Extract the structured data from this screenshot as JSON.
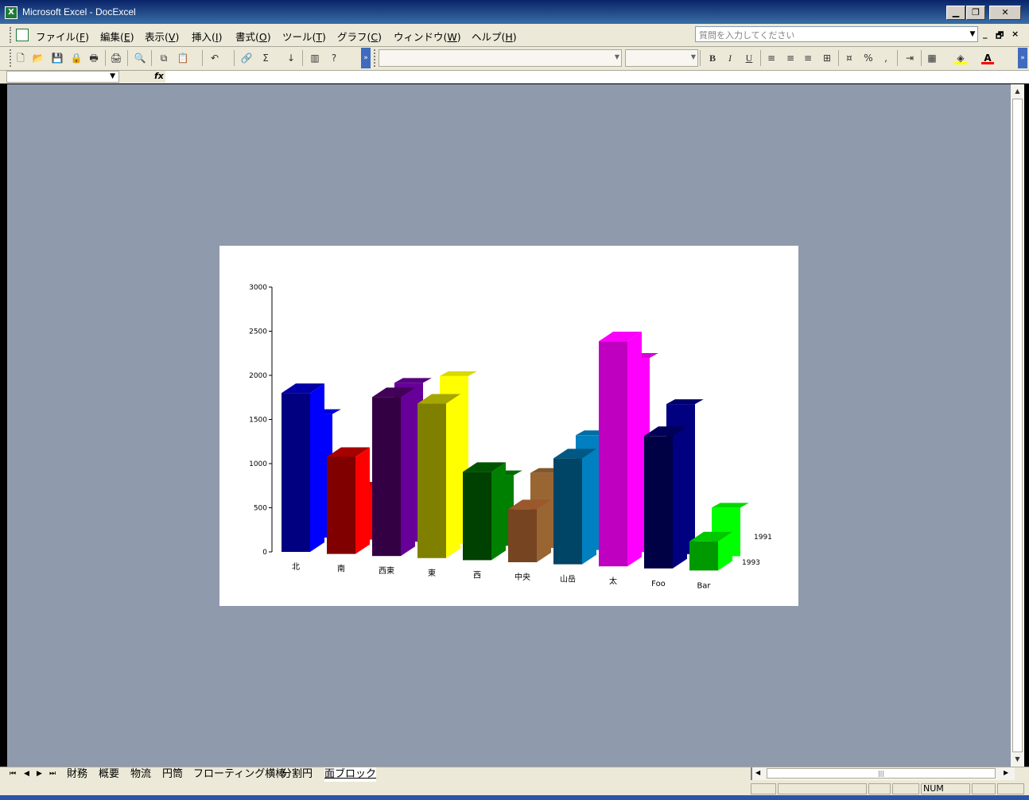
{
  "window": {
    "title": "Microsoft Excel - DocExcel",
    "btn_min": "▁",
    "btn_restore": "❐",
    "btn_close": "✕"
  },
  "menu": {
    "items": [
      {
        "label": "ファイル(",
        "key": "F",
        "end": ")"
      },
      {
        "label": "編集(",
        "key": "E",
        "end": ")"
      },
      {
        "label": "表示(",
        "key": "V",
        "end": ")"
      },
      {
        "label": "挿入(",
        "key": "I",
        "end": ")"
      },
      {
        "label": "書式(",
        "key": "O",
        "end": ")"
      },
      {
        "label": "ツール(",
        "key": "T",
        "end": ")"
      },
      {
        "label": "グラフ(",
        "key": "C",
        "end": ")"
      },
      {
        "label": "ウィンドウ(",
        "key": "W",
        "end": ")"
      },
      {
        "label": "ヘルプ(",
        "key": "H",
        "end": ")"
      }
    ],
    "help_placeholder": "質問を入力してください",
    "doc_min": "_",
    "doc_restore": "🗗",
    "doc_close": "×"
  },
  "toolbar": {
    "icons": [
      "new-icon",
      "open-icon",
      "save-icon",
      "permission-icon",
      "print-preview-icon",
      "print-icon",
      "research-icon",
      "copy-icon",
      "paste-icon",
      "undo-icon",
      "hyperlink-icon",
      "autosum-icon",
      "sort-icon",
      "chart-wizard-icon",
      "help-icon"
    ],
    "glyphs": [
      "🗋",
      "📂",
      "💾",
      "🔒",
      "🖶",
      "🖨",
      "🔍",
      "⧉",
      "📋",
      "↶",
      "🔗",
      "Σ",
      "↓",
      "▥",
      "?"
    ],
    "format_glyphs": {
      "bold": "B",
      "italic": "I",
      "underline": "U",
      "align_left": "≡",
      "align_center": "≡",
      "align_right": "≡",
      "merge": "⊞",
      "currency": "¤",
      "percent": "%",
      "comma": ",",
      "indent": "⇥",
      "borders": "▦",
      "fill": "◈",
      "font_color": "A"
    },
    "colors": {
      "fill": "#ffff00",
      "font": "#ff0000"
    }
  },
  "formula": {
    "fx": "fx"
  },
  "sheets": {
    "tabs": [
      "財務",
      "概要",
      "物流",
      "円筒",
      "フローティング横棒",
      "分割円",
      "面ブロック"
    ],
    "active": 6
  },
  "status": {
    "num": "NUM"
  },
  "colors": {
    "workspace": "#909aad",
    "accent": "#0a246a"
  },
  "chart_data": {
    "type": "bar",
    "variant": "3d-column",
    "categories": [
      "北",
      "南",
      "西東",
      "東",
      "西",
      "中央",
      "山岳",
      "太",
      "Foo",
      "Bar"
    ],
    "series": [
      {
        "name": "1991",
        "values": [
          1400,
          600,
          1800,
          1900,
          800,
          850,
          1300,
          2200,
          1700,
          550
        ],
        "colors": [
          "#0000ff",
          "#ff0000",
          "#660099",
          "#ffff00",
          "#008000",
          "#996633",
          "#0080c0",
          "#ff00ff",
          "#000080",
          "#00ff00"
        ]
      },
      {
        "name": "1993",
        "values": [
          1800,
          1100,
          1800,
          1750,
          1000,
          600,
          1200,
          2550,
          1500,
          330
        ],
        "colors": [
          "#000080",
          "#800000",
          "#330044",
          "#808000",
          "#004000",
          "#774422",
          "#004466",
          "#c000c0",
          "#000044",
          "#009900"
        ]
      }
    ],
    "yticks": [
      0,
      500,
      1000,
      1500,
      2000,
      2500,
      3000
    ],
    "ylim": [
      0,
      3000
    ],
    "grid": false,
    "legend": "none"
  }
}
